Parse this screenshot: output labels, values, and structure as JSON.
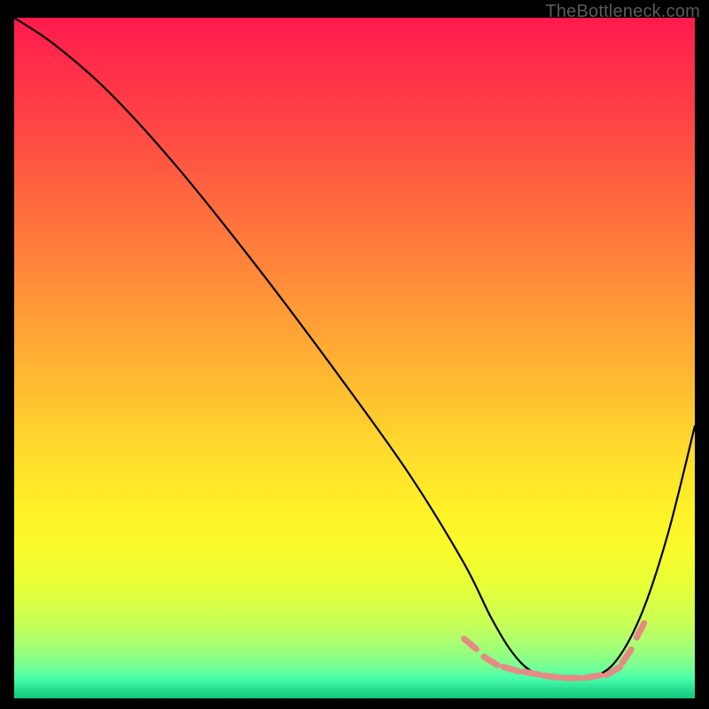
{
  "watermark": "TheBottleneck.com",
  "chart_data": {
    "type": "line",
    "title": "",
    "xlabel": "",
    "ylabel": "",
    "xlim": [
      0,
      100
    ],
    "ylim": [
      0,
      100
    ],
    "grid": false,
    "legend": false,
    "series": [
      {
        "name": "curve",
        "color": "#000000",
        "x": [
          0,
          6,
          14,
          24,
          36,
          48,
          58,
          66,
          70,
          73,
          76,
          80,
          84,
          88,
          92,
          96,
          100
        ],
        "values": [
          100,
          96,
          89,
          78,
          63,
          47,
          33,
          20,
          12,
          7,
          4,
          3,
          3,
          5,
          12,
          24,
          40
        ]
      }
    ],
    "markers": {
      "name": "dash-band",
      "color": "#e58a84",
      "x": [
        67,
        70,
        73,
        76,
        79,
        82,
        85,
        88,
        90,
        92
      ],
      "values": [
        8.0,
        5.5,
        4.3,
        3.7,
        3.2,
        3.0,
        3.2,
        4.0,
        6.2,
        10.0
      ]
    }
  }
}
